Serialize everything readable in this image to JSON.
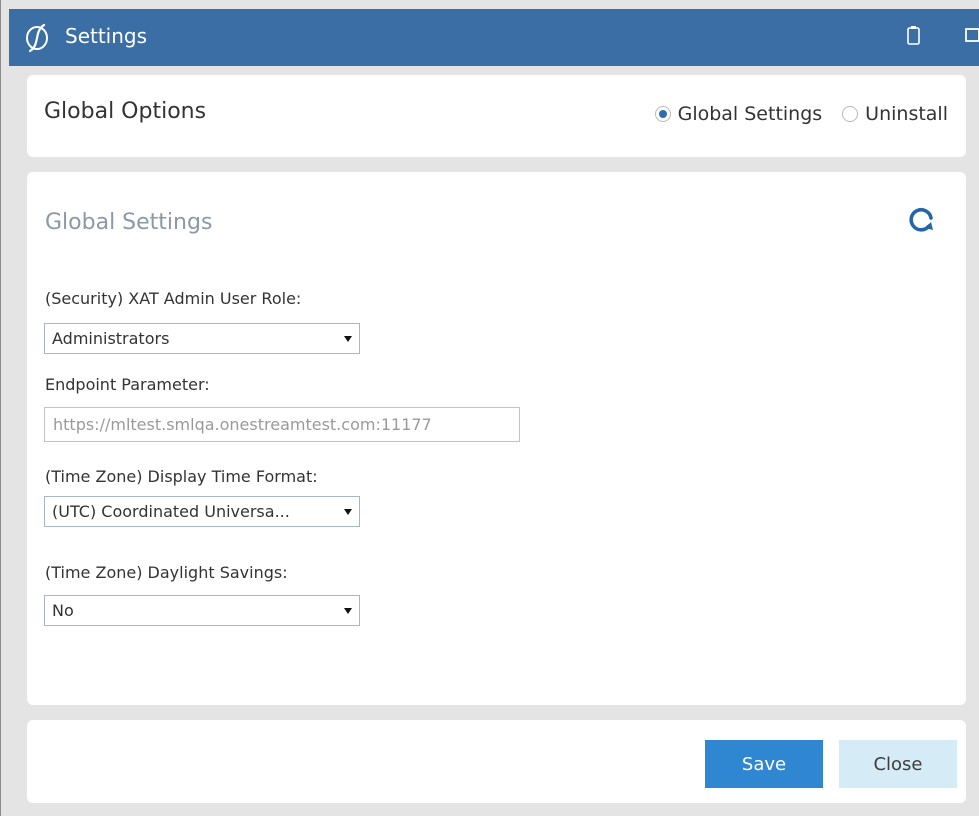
{
  "window": {
    "title": "Settings",
    "icons": [
      "onestream-logo-icon",
      "clipboard-icon",
      "maximize-icon"
    ]
  },
  "header": {
    "title": "Global Options",
    "radio_options": [
      {
        "label": "Global Settings",
        "selected": true
      },
      {
        "label": "Uninstall",
        "selected": false
      }
    ]
  },
  "main": {
    "section_title": "Global Settings",
    "refresh_icon": "refresh-icon",
    "fields": {
      "admin_role": {
        "label": "(Security) XAT Admin User Role:",
        "value": "Administrators"
      },
      "endpoint": {
        "label": "Endpoint Parameter:",
        "placeholder": "https://mltest.smlqa.onestreamtest.com:11177"
      },
      "time_format": {
        "label": "(Time Zone) Display Time Format:",
        "value": "(UTC) Coordinated Universa..."
      },
      "daylight_savings": {
        "label": "(Time Zone) Daylight Savings:",
        "value": "No"
      }
    }
  },
  "footer": {
    "save_label": "Save",
    "close_label": "Close"
  },
  "colors": {
    "titlebar": "#3a6ea5",
    "save_button": "#2f86d1",
    "close_button": "#d5ecf7",
    "section_title": "#8a99a6",
    "radio_selected": "#2f6db3",
    "refresh_icon": "#2266a8"
  }
}
